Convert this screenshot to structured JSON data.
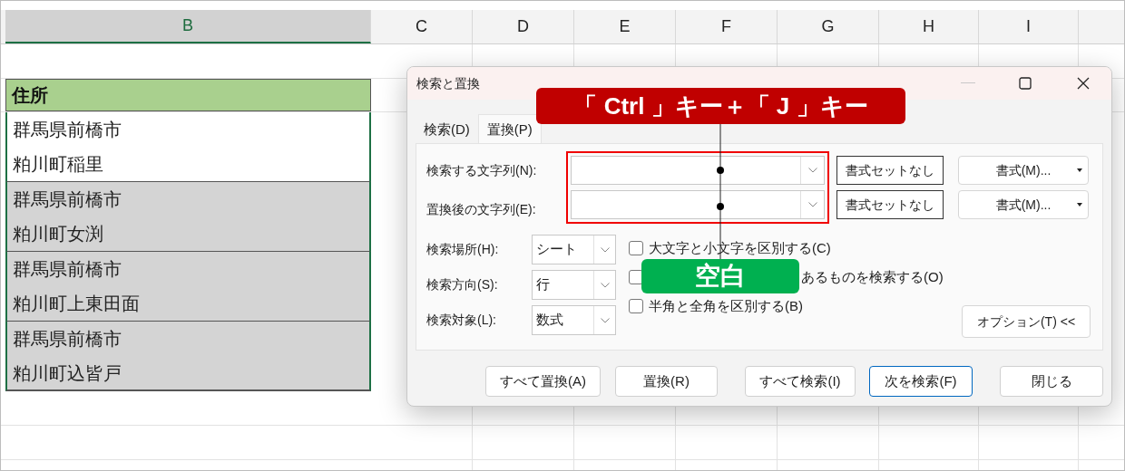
{
  "sheet": {
    "columns": [
      {
        "label": "B",
        "selected": true
      },
      {
        "label": "C",
        "selected": false
      },
      {
        "label": "D",
        "selected": false
      },
      {
        "label": "E",
        "selected": false
      },
      {
        "label": "F",
        "selected": false
      },
      {
        "label": "G",
        "selected": false
      },
      {
        "label": "H",
        "selected": false
      },
      {
        "label": "I",
        "selected": false
      }
    ],
    "header": "住所",
    "cells": [
      {
        "text": "群馬県前橋市",
        "selected": false
      },
      {
        "text": "粕川町稲里",
        "selected": false
      },
      {
        "text": "群馬県前橋市",
        "selected": true
      },
      {
        "text": "粕川町女渕",
        "selected": true
      },
      {
        "text": "群馬県前橋市",
        "selected": true
      },
      {
        "text": "粕川町上東田面",
        "selected": true
      },
      {
        "text": "群馬県前橋市",
        "selected": true
      },
      {
        "text": "粕川町込皆戸",
        "selected": true
      }
    ]
  },
  "dialog": {
    "title": "検索と置換",
    "tabs": [
      {
        "label": "検索(D)",
        "selected": false
      },
      {
        "label": "置換(P)",
        "selected": true
      }
    ],
    "fields": [
      {
        "label": "検索する文字列(N):",
        "format_status": "書式セットなし",
        "format_button": "書式(M)..."
      },
      {
        "label": "置換後の文字列(E):",
        "format_status": "書式セットなし",
        "format_button": "書式(M)..."
      }
    ],
    "selects": [
      {
        "label": "検索場所(H):",
        "value": "シート"
      },
      {
        "label": "検索方向(S):",
        "value": "行"
      },
      {
        "label": "検索対象(L):",
        "value": "数式"
      }
    ],
    "checkboxes": [
      {
        "label": "大文字と小文字を区別する(C)",
        "checked": false
      },
      {
        "label": "あるものを検索する(O)",
        "checked": false
      },
      {
        "label": "半角と全角を区別する(B)",
        "checked": false
      }
    ],
    "options_button": "オプション(T) <<",
    "buttons": [
      {
        "label": "すべて置換(A)",
        "default": false
      },
      {
        "label": "置換(R)",
        "default": false
      },
      {
        "label": "すべて検索(I)",
        "default": false
      },
      {
        "label": "次を検索(F)",
        "default": true
      },
      {
        "label": "閉じる",
        "default": false
      }
    ]
  },
  "callouts": [
    {
      "text": "「 Ctrl 」キー＋「 J 」キー",
      "color": "#c00000"
    },
    {
      "text": "空白",
      "color": "#00b050"
    }
  ]
}
